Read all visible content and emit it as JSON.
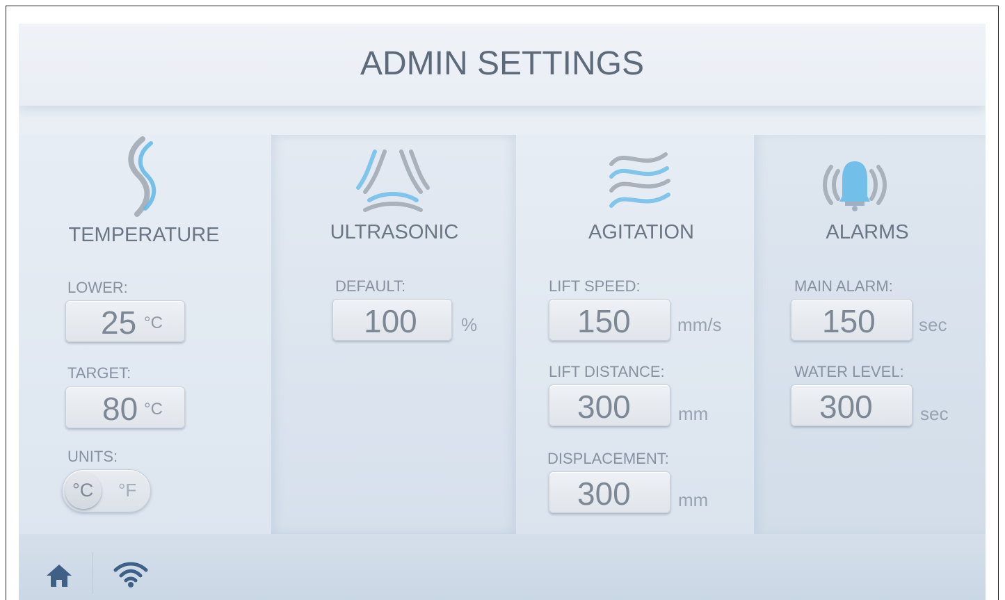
{
  "header": {
    "title": "ADMIN SETTINGS"
  },
  "colors": {
    "accent": "#5fb8e8",
    "icon_gray": "#a9b1ba",
    "text": "#6a7684",
    "footer_icon": "#3f5f86"
  },
  "temperature": {
    "title": "TEMPERATURE",
    "icon": "temperature-wave-icon",
    "lower": {
      "label": "LOWER:",
      "value": "25",
      "unit": "°C"
    },
    "target": {
      "label": "TARGET:",
      "value": "80",
      "unit": "°C"
    },
    "units": {
      "label": "UNITS:",
      "celsius": "°C",
      "fahrenheit": "°F",
      "selected": "°C"
    }
  },
  "ultrasonic": {
    "title": "ULTRASONIC",
    "icon": "ultrasonic-waves-icon",
    "default": {
      "label": "DEFAULT:",
      "value": "100",
      "unit": "%"
    }
  },
  "agitation": {
    "title": "AGITATION",
    "icon": "agitation-waves-icon",
    "lift_speed": {
      "label": "LIFT SPEED:",
      "value": "150",
      "unit": "mm/s"
    },
    "lift_distance": {
      "label": "LIFT DISTANCE:",
      "value": "300",
      "unit": "mm"
    },
    "displacement": {
      "label": "DISPLACEMENT:",
      "value": "300",
      "unit": "mm"
    }
  },
  "alarms": {
    "title": "ALARMS",
    "icon": "bell-icon",
    "main_alarm": {
      "label": "MAIN ALARM:",
      "value": "150",
      "unit": "sec"
    },
    "water_level": {
      "label": "WATER LEVEL:",
      "value": "300",
      "unit": "sec"
    }
  },
  "footer": {
    "home_icon": "home-icon",
    "wifi_icon": "wifi-icon"
  }
}
